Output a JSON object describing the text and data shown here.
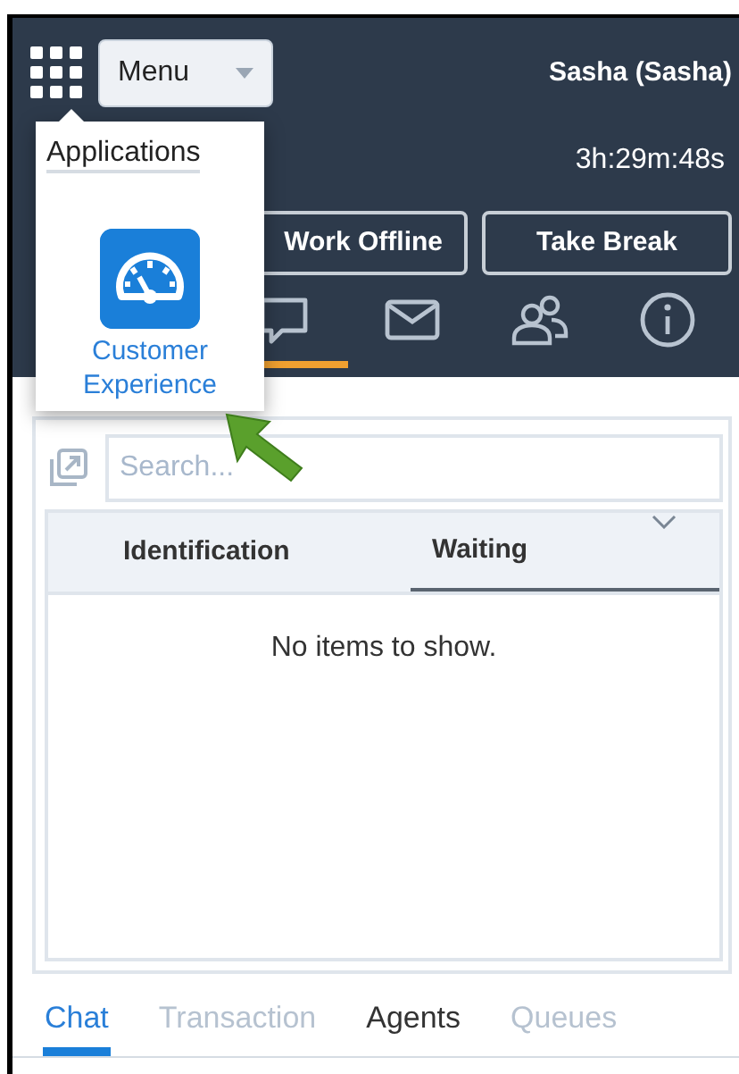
{
  "header": {
    "menu_button": "Menu",
    "user": "Sasha (Sasha)",
    "timer": "3h:29m:48s",
    "buttons": [
      "Work Offline",
      "Take Break"
    ],
    "icon_tabs": [
      {
        "kind": "chat",
        "selected": true
      },
      {
        "kind": "mail",
        "selected": false
      },
      {
        "kind": "people",
        "selected": false
      },
      {
        "kind": "info",
        "selected": false
      }
    ]
  },
  "applications_popup": {
    "title": "Applications",
    "apps": [
      {
        "label": "Customer Experience"
      }
    ]
  },
  "search": {
    "placeholder": "Search..."
  },
  "table": {
    "columns": [
      {
        "label": "Identification",
        "sorted": false
      },
      {
        "label": "Waiting",
        "sorted": true
      }
    ],
    "empty_message": "No items to show."
  },
  "bottom_tabs": [
    {
      "label": "Chat",
      "selected": true,
      "disabled": false
    },
    {
      "label": "Transaction",
      "selected": false,
      "disabled": true
    },
    {
      "label": "Agents",
      "selected": false,
      "disabled": false
    },
    {
      "label": "Queues",
      "selected": false,
      "disabled": true
    }
  ]
}
